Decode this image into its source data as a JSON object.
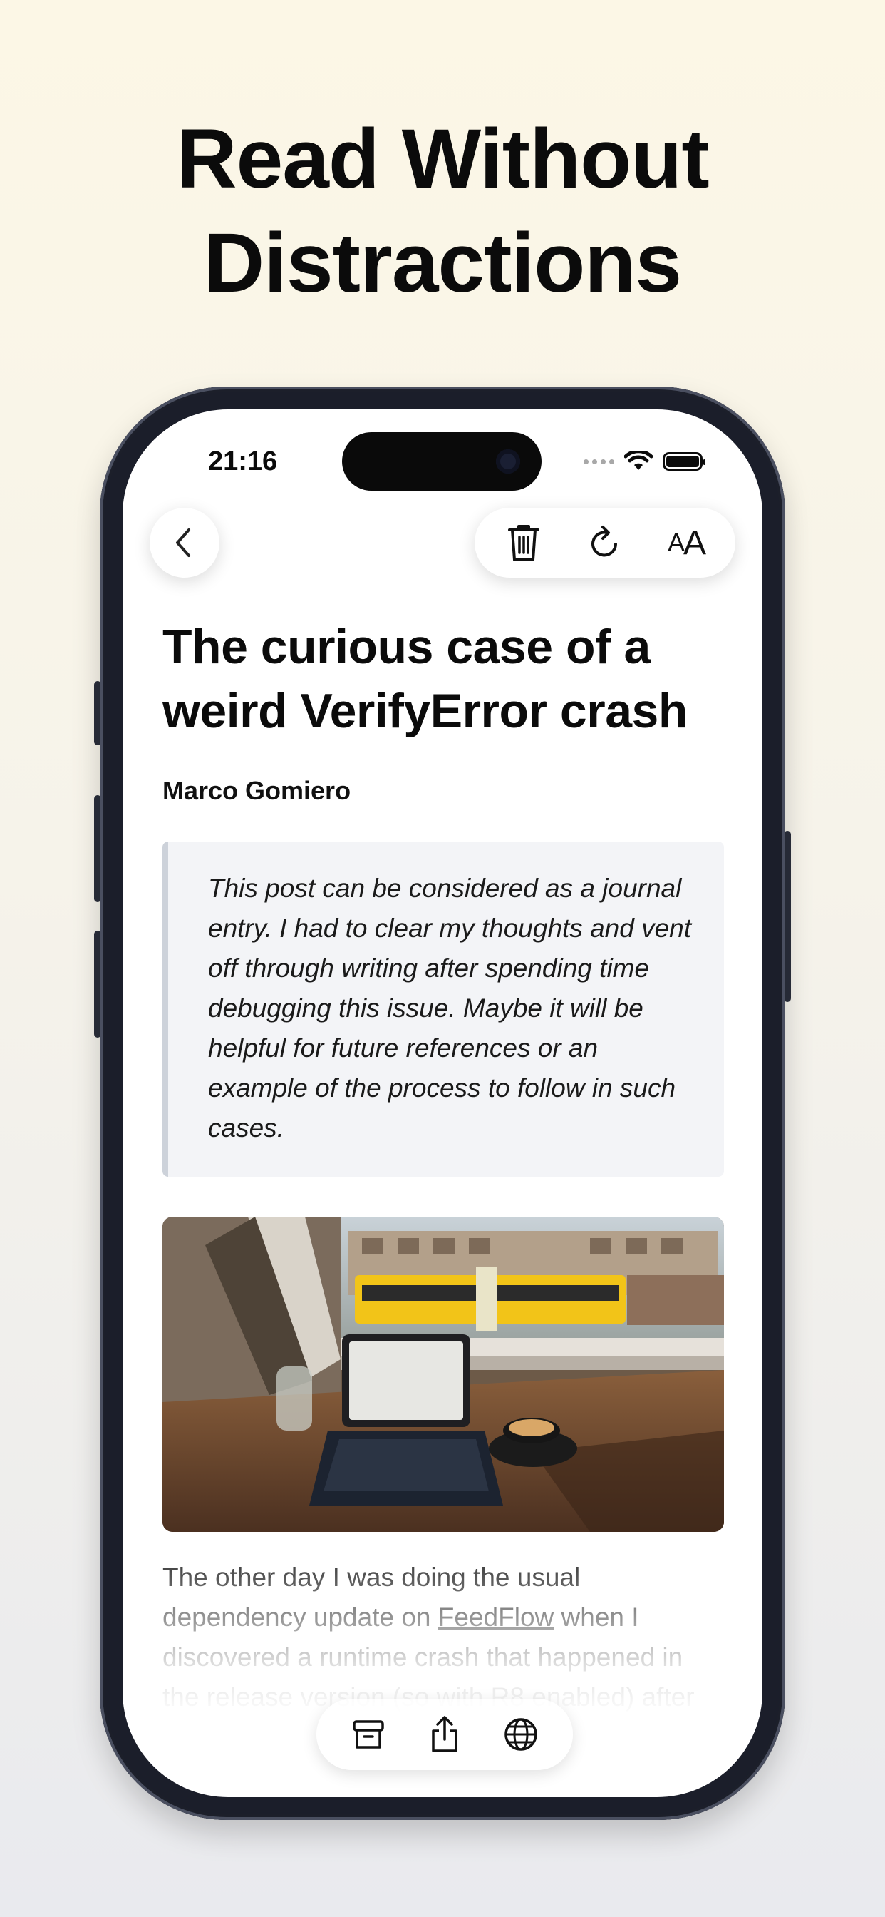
{
  "promo": {
    "headline_line1": "Read Without",
    "headline_line2": "Distractions"
  },
  "status_bar": {
    "time": "21:16",
    "icons": [
      "signal-dots-icon",
      "wifi-icon",
      "battery-icon"
    ]
  },
  "top_toolbar": {
    "back_icon": "chevron-left-icon",
    "actions": [
      "trash-icon",
      "refresh-icon",
      "text-size-icon"
    ],
    "text_size_small": "A",
    "text_size_large": "A"
  },
  "article": {
    "title": "The curious case of a weird VerifyError crash",
    "author": "Marco Gomiero",
    "quote": "This post can be considered as a journal entry. I had to clear my thoughts and vent off through writing after spending time debugging this issue. Maybe it will be helpful for future references or an example of the process to follow in such cases.",
    "body_start": "The other day I was doing the usual dependency update on ",
    "body_link": "FeedFlow",
    "body_end": " when I discovered a runtime crash that happened in the release version (so with R8 enabled) after"
  },
  "bottom_toolbar": {
    "actions": [
      "archive-icon",
      "share-icon",
      "globe-icon"
    ]
  },
  "colors": {
    "background_top": "#fcf7e6",
    "background_bottom": "#e9eaee",
    "phone_frame": "#1b1e2a",
    "quote_bg": "#f3f4f7",
    "quote_border": "#cdd2da"
  }
}
